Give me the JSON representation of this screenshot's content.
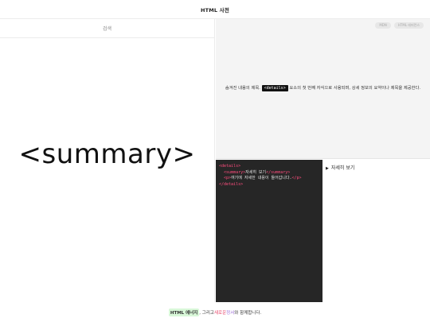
{
  "header": {
    "title": "HTML 사전"
  },
  "sidebar": {
    "search_label": "검색",
    "tag_name": "<summary>"
  },
  "info": {
    "badges": [
      "MDN",
      "HTML 레퍼런스"
    ],
    "desc_before": "숨겨진 내용의 제목. ",
    "desc_code": "<details>",
    "desc_after": " 요소의 첫 번째 자식으로 사용되며, 상세 정보의 요약이나 제목을 제공한다."
  },
  "code": {
    "lines": [
      {
        "indent": "",
        "tag_open": "<details>",
        "text": "",
        "tag_close": ""
      },
      {
        "indent": "  ",
        "tag_open": "<summary>",
        "text": "자세히 보기",
        "tag_close": "</summary>"
      },
      {
        "indent": "  ",
        "tag_open": "<p>",
        "text": "여기에 자세한 내용이 들어갑니다.",
        "tag_close": "</p>"
      },
      {
        "indent": "",
        "tag_open": "</details>",
        "text": "",
        "tag_close": ""
      }
    ]
  },
  "preview": {
    "marker": "▶",
    "summary_text": "자세히 보기"
  },
  "footer": {
    "part1": "HTML 에너지",
    "part2": ", 그리고 ",
    "part3": "새로운",
    "part4": " ",
    "part5": "정서",
    "part6": "와 함께합니다."
  },
  "colors": {
    "code_bg": "#262626",
    "tag_color": "#ff4d7e",
    "footer_highlight": "#d8f7d8"
  }
}
